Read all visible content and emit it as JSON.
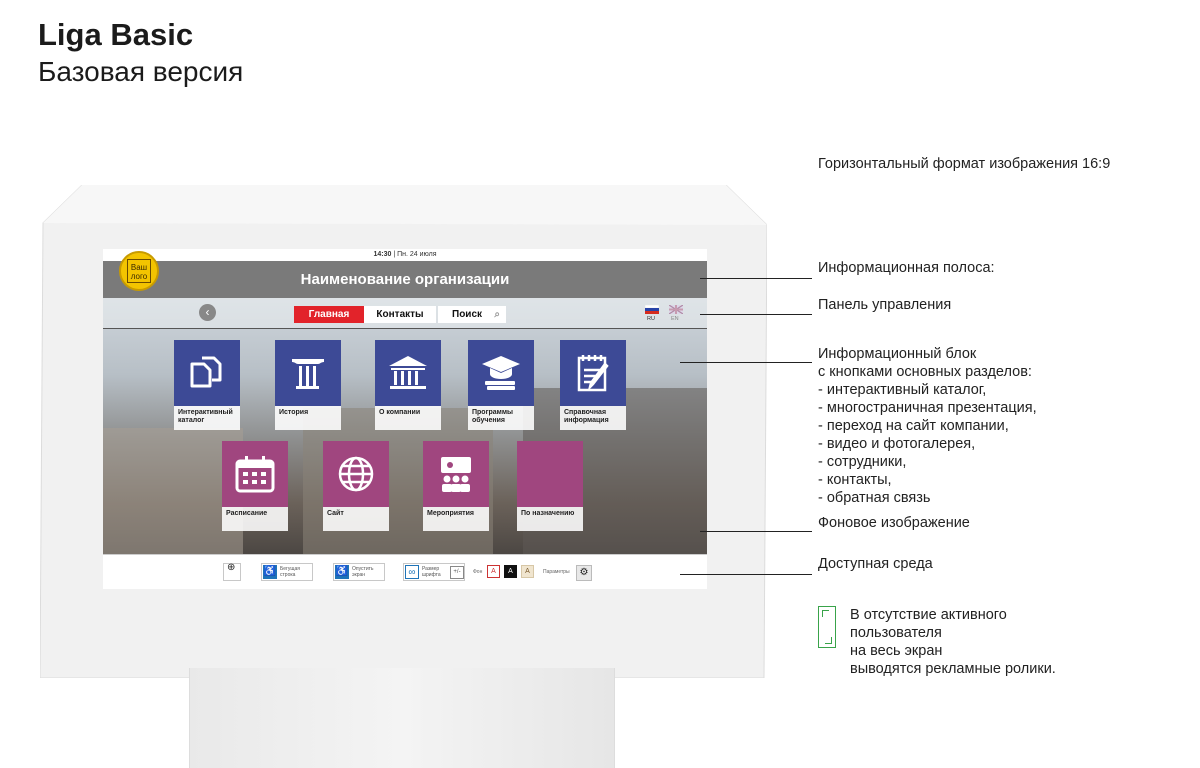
{
  "header": {
    "title": "Liga Basic",
    "subtitle": "Базовая версия"
  },
  "format_note": "Горизонтальный формат изображения 16:9",
  "screen": {
    "status_time": "14:30",
    "status_date": "Пн. 24 июля",
    "org_name": "Наименование организации",
    "logo_text": "Ваш лого",
    "nav": {
      "main": "Главная",
      "contacts": "Контакты",
      "search": "Поиск"
    },
    "languages": [
      "RU",
      "EN"
    ],
    "tiles": [
      {
        "label": "Интерактивный каталог",
        "color": "#3d4a96",
        "icon": "documents-icon"
      },
      {
        "label": "История",
        "color": "#3d4a96",
        "icon": "column-icon"
      },
      {
        "label": "О компании",
        "color": "#3d4a96",
        "icon": "building-icon"
      },
      {
        "label": "Программы обучения",
        "color": "#3d4a96",
        "icon": "graduation-cap-icon"
      },
      {
        "label": "Справочная информация",
        "color": "#3d4a96",
        "icon": "notepad-icon"
      },
      {
        "label": "Расписание",
        "color": "#a0467f",
        "icon": "calendar-icon"
      },
      {
        "label": "Сайт",
        "color": "#a0467f",
        "icon": "globe-icon"
      },
      {
        "label": "Мероприятия",
        "color": "#a0467f",
        "icon": "audience-icon"
      },
      {
        "label": "По назначению",
        "color": "#a0467f",
        "icon": ""
      }
    ],
    "accessibility": {
      "ticker": "Бегущая строка",
      "lower_screen": "Опустить экран",
      "font_size": "Размер шрифта",
      "plus_minus": "+/-",
      "background": "Фон",
      "font_a": "A",
      "params": "Параметры"
    }
  },
  "annotations": {
    "info_bar": "Информационная полоса:",
    "control_panel": "Панель управления",
    "info_block": [
      "Информационный блок",
      "с кнопками основных разделов:",
      "- интерактивный каталог,",
      "- многостраничная презентация,",
      "- переход на сайт компании,",
      "- видео и фотогалерея,",
      "- сотрудники,",
      "- контакты,",
      "- обратная связь"
    ],
    "background": "Фоновое изображение",
    "accessible": "Доступная среда",
    "idle": [
      "В отсутствие активного",
      "пользователя",
      "на весь экран",
      "выводятся рекламные ролики."
    ]
  }
}
